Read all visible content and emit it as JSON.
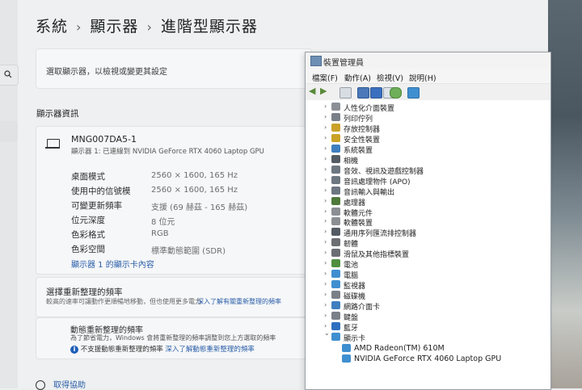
{
  "breadcrumb": {
    "item1": "系統",
    "item2": "顯示器",
    "current": "進階型顯示器"
  },
  "select_display": {
    "label": "選取顯示器，以檢視或變更其設定"
  },
  "display_info": {
    "section_title": "顯示器資訊",
    "monitor_name": "MNG007DA5-1",
    "monitor_desc": "顯示器 1: 已連線到 NVIDIA GeForce RTX 4060 Laptop GPU",
    "rows": [
      {
        "label": "桌面模式",
        "value": "2560 × 1600, 165 Hz"
      },
      {
        "label": "使用中的信號模",
        "value": "2560 × 1600, 165 Hz"
      },
      {
        "label": "可變更新頻率",
        "value": "支援 (69 赫茲 - 165 赫茲)"
      },
      {
        "label": "位元深度",
        "value": "8 位元"
      },
      {
        "label": "色彩格式",
        "value": "RGB"
      },
      {
        "label": "色彩空間",
        "value": "標準動態範圍 (SDR)"
      }
    ],
    "adapter_link": "顯示器 1 的顯示卡內容"
  },
  "refresh": {
    "title": "選擇重新整理的頻率",
    "desc": "較高的速率可讓動作更順暢地移動，但也使用更多電力",
    "desc_link": "深入了解有關重新整理的頻率",
    "dynamic_title": "動態重新整理的頻率",
    "dynamic_desc": "為了節省電力，Windows 會將重新整理的頻率調整到您上方選取的頻率",
    "info_icon_text": "i",
    "unsupported": "不支援動態重新整理的頻率",
    "unsupported_link": "深入了解動態重新整理的頻率"
  },
  "help_link": "取得協助",
  "device_manager": {
    "title": "裝置管理員",
    "menu": [
      "檔案(F)",
      "動作(A)",
      "檢視(V)",
      "說明(H)"
    ],
    "categories": [
      {
        "label": "人性化介面裝置",
        "icon_color": "#8a8f96",
        "icon": "hid-icon"
      },
      {
        "label": "列印佇列",
        "icon_color": "#7a8088",
        "icon": "printer-icon"
      },
      {
        "label": "存放控制器",
        "icon_color": "#c9a227",
        "icon": "storage-icon"
      },
      {
        "label": "安全性裝置",
        "icon_color": "#c9a227",
        "icon": "security-icon"
      },
      {
        "label": "系統裝置",
        "icon_color": "#3f7fbf",
        "icon": "system-icon"
      },
      {
        "label": "相機",
        "icon_color": "#555b62",
        "icon": "camera-icon"
      },
      {
        "label": "音效、視訊及遊戲控制器",
        "icon_color": "#6d7780",
        "icon": "sound-icon"
      },
      {
        "label": "音訊處理物件 (APO)",
        "icon_color": "#6d7780",
        "icon": "apo-icon"
      },
      {
        "label": "音訊輸入與輸出",
        "icon_color": "#6d7780",
        "icon": "audio-io-icon"
      },
      {
        "label": "處理器",
        "icon_color": "#4e7a3a",
        "icon": "processor-icon"
      },
      {
        "label": "軟體元件",
        "icon_color": "#8b8f93",
        "icon": "software-component-icon"
      },
      {
        "label": "軟體裝置",
        "icon_color": "#8b8f93",
        "icon": "software-device-icon"
      },
      {
        "label": "通用序列匯流排控制器",
        "icon_color": "#555b62",
        "icon": "usb-icon"
      },
      {
        "label": "韌體",
        "icon_color": "#6b6f74",
        "icon": "firmware-icon"
      },
      {
        "label": "滑鼠及其他指標裝置",
        "icon_color": "#6b6f74",
        "icon": "mouse-icon"
      },
      {
        "label": "電池",
        "icon_color": "#4f8f3f",
        "icon": "battery-icon"
      },
      {
        "label": "電腦",
        "icon_color": "#3f8fd0",
        "icon": "computer-icon"
      },
      {
        "label": "監視器",
        "icon_color": "#3f8fd0",
        "icon": "monitor-icon"
      },
      {
        "label": "磁碟機",
        "icon_color": "#7a8088",
        "icon": "disk-icon"
      },
      {
        "label": "網路介面卡",
        "icon_color": "#3f7fbf",
        "icon": "network-icon"
      },
      {
        "label": "鍵盤",
        "icon_color": "#7a8088",
        "icon": "keyboard-icon"
      },
      {
        "label": "藍牙",
        "icon_color": "#2d6fc0",
        "icon": "bluetooth-icon"
      },
      {
        "label": "顯示卡",
        "icon_color": "#3f8fd0",
        "icon": "display-adapter-icon"
      }
    ],
    "display_adapters": [
      {
        "label": "AMD Radeon(TM) 610M"
      },
      {
        "label": "NVIDIA GeForce RTX 4060 Laptop GPU"
      }
    ]
  }
}
